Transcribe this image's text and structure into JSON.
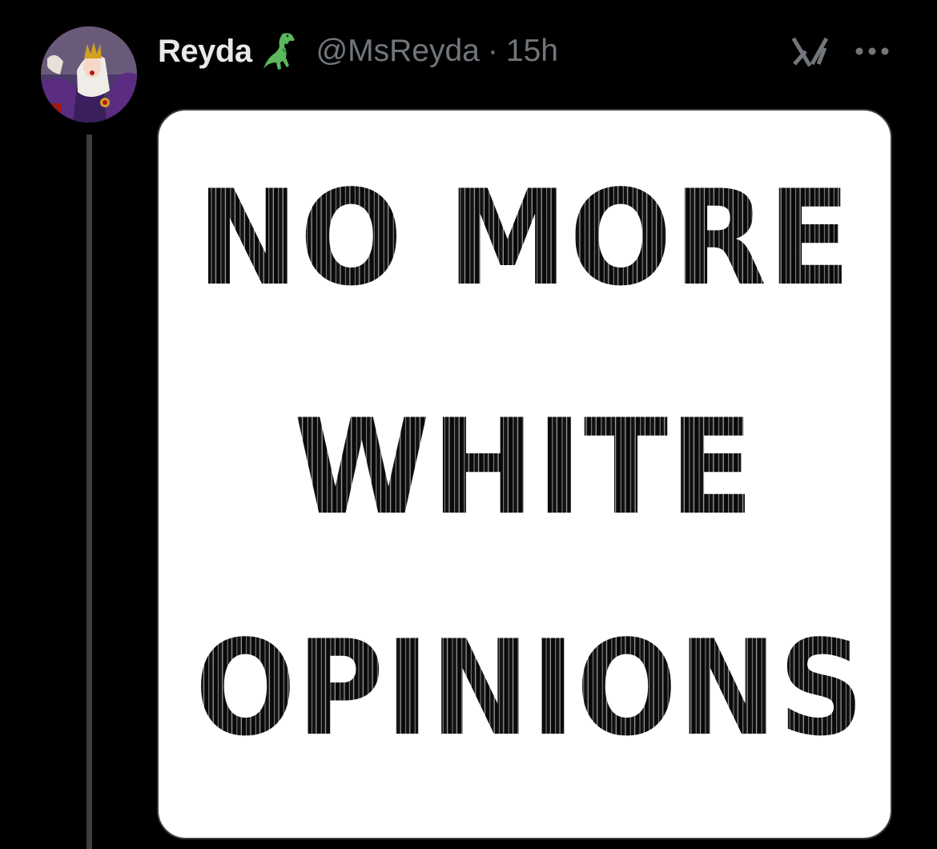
{
  "tweet": {
    "display_name": "Reyda",
    "name_emoji_icon": "t-rex-dinosaur-icon",
    "handle": "@MsReyda",
    "separator": "·",
    "time_ago": "15h",
    "actions": {
      "grok_icon": "grok-logo-icon",
      "more_icon": "more-options-icon"
    },
    "media": {
      "text_lines": [
        "NO MORE",
        "WHITE",
        "OPINIONS"
      ]
    }
  },
  "colors": {
    "background": "#000000",
    "name_text": "#e7e9ea",
    "secondary_text": "#71767b",
    "thread_line": "#3a3d42",
    "card_bg": "#ffffff",
    "dino_green": "#5cb85c"
  }
}
